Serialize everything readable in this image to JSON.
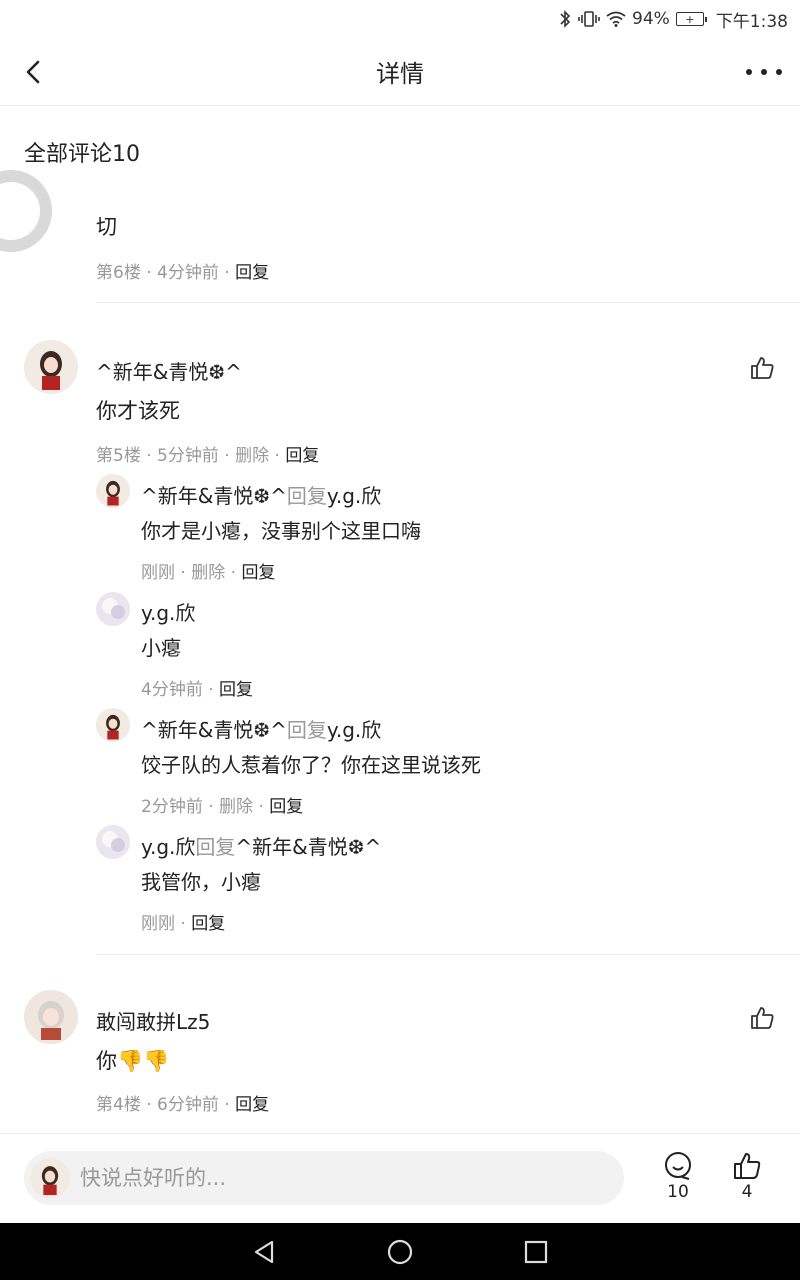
{
  "status_bar": {
    "battery": "94%",
    "time": "下午1:38",
    "battery_plus": "+"
  },
  "header": {
    "title": "详情"
  },
  "section_title": "全部评论10",
  "comments": [
    {
      "name": "",
      "text": "切",
      "meta": {
        "floor": "第6楼",
        "time": "4分钟前",
        "reply": "回复"
      }
    },
    {
      "name": "^新年&青悦❆^",
      "text": "你才该死",
      "meta": {
        "floor": "第5楼",
        "time": "5分钟前",
        "delete": "删除",
        "reply": "回复"
      },
      "replies": [
        {
          "name": "^新年&青悦❆^",
          "reply_word": "回复",
          "target": "y.g.欣",
          "text": "你才是小瘪，没事别个这里口嗨",
          "time": "刚刚",
          "delete": "删除",
          "reply": "回复"
        },
        {
          "name": "y.g.欣",
          "text": "小瘪",
          "time": "4分钟前",
          "reply": "回复"
        },
        {
          "name": "^新年&青悦❆^",
          "reply_word": "回复",
          "target": "y.g.欣",
          "text": "饺子队的人惹着你了？你在这里说该死",
          "time": "2分钟前",
          "delete": "删除",
          "reply": "回复"
        },
        {
          "name": "y.g.欣",
          "reply_word": "回复",
          "target": "^新年&青悦❆^",
          "text": "我管你，小瘪",
          "time": "刚刚",
          "reply": "回复"
        }
      ]
    },
    {
      "name": "敢闯敢拼Lz5",
      "text": "你👎👎",
      "meta": {
        "floor": "第4楼",
        "time": "6分钟前",
        "reply": "回复"
      }
    }
  ],
  "bottom_bar": {
    "placeholder": "快说点好听的...",
    "comment_count": "10",
    "like_count": "4"
  },
  "colors": {
    "muted": "#999999",
    "text": "#222222",
    "divider": "#ededed",
    "input_bg": "#f2f2f2"
  }
}
